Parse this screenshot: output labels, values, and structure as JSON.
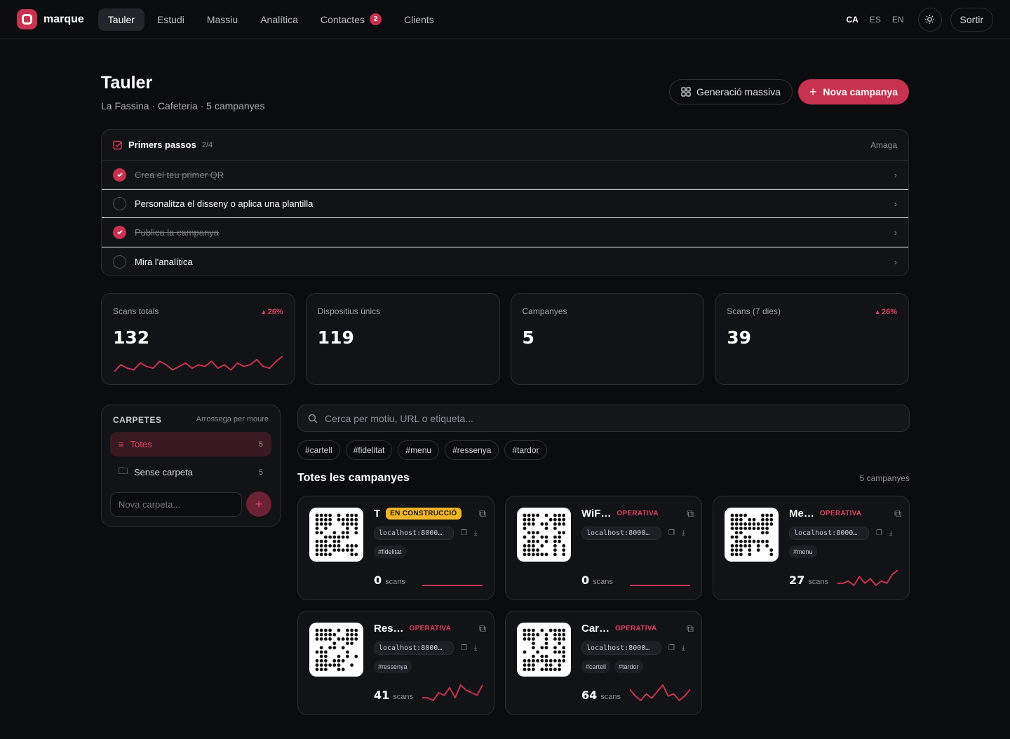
{
  "brand": {
    "name": "marque"
  },
  "nav": [
    {
      "label": "Tauler",
      "active": true
    },
    {
      "label": "Estudi"
    },
    {
      "label": "Massiu"
    },
    {
      "label": "Analítica"
    },
    {
      "label": "Contactes",
      "badge": "2"
    },
    {
      "label": "Clients"
    }
  ],
  "langs": [
    "CA",
    "ES",
    "EN"
  ],
  "signout": "Sortir",
  "page": {
    "title": "Tauler",
    "subtitle": "La Fassina · Cafeteria · 5 campanyes",
    "bulk_button": "Generació massiva",
    "new_button": "Nova campanya"
  },
  "steps": {
    "title": "Primers passos",
    "count": "2/4",
    "hide": "Amaga",
    "items": [
      {
        "label": "Crea el teu primer QR",
        "done": true
      },
      {
        "label": "Personalitza el disseny o aplica una plantilla",
        "done": false
      },
      {
        "label": "Publica la campanya",
        "done": true
      },
      {
        "label": "Mira l'analítica",
        "done": false
      }
    ]
  },
  "stats": [
    {
      "label": "Scans totals",
      "value": "132",
      "delta": "26%",
      "spark": [
        3,
        7,
        5,
        4,
        8,
        6,
        5,
        9,
        7,
        4,
        6,
        8,
        5,
        7,
        6,
        9,
        5,
        7,
        4,
        8,
        6,
        7,
        10,
        6,
        5,
        9,
        12
      ]
    },
    {
      "label": "Dispositius únics",
      "value": "119",
      "delta": ""
    },
    {
      "label": "Campanyes",
      "value": "5",
      "delta": ""
    },
    {
      "label": "Scans (7 dies)",
      "value": "39",
      "delta": "26%"
    }
  ],
  "folders": {
    "title": "CARPETES",
    "hint": "Arrossega per moure",
    "items": [
      {
        "label": "Totes",
        "count": "5",
        "active": true
      },
      {
        "label": "Sense carpeta",
        "count": "5"
      }
    ],
    "new_placeholder": "Nova carpeta..."
  },
  "search": {
    "placeholder": "Cerca per motiu, URL o etiqueta..."
  },
  "tags": [
    "#cartell",
    "#fidelitat",
    "#menu",
    "#ressenya",
    "#tardor"
  ],
  "campaigns": {
    "title": "Totes les campanyes",
    "count": "5 campanyes",
    "items": [
      {
        "name": "T",
        "status": "EN CONSTRUCCIÓ",
        "building": true,
        "url": "localhost:8000…",
        "tags": [
          "#fidelitat"
        ],
        "scans": "0",
        "scans_label": "scans",
        "spark": [
          0,
          0,
          0,
          0,
          0,
          0,
          0,
          0
        ]
      },
      {
        "name": "WiF…",
        "status": "OPERATIVA",
        "url": "localhost:8000…",
        "tags": [],
        "scans": "0",
        "scans_label": "scans",
        "spark": [
          0,
          0,
          0,
          0,
          0,
          0,
          0,
          0
        ]
      },
      {
        "name": "Me…",
        "status": "OPERATIVA",
        "url": "localhost:8000…",
        "tags": [
          "#menu"
        ],
        "scans": "27",
        "scans_label": "scans",
        "spark": [
          2,
          2,
          3,
          1,
          5,
          2,
          4,
          1,
          3,
          2,
          6,
          8
        ]
      },
      {
        "name": "Res…",
        "status": "OPERATIVA",
        "url": "localhost:8000…",
        "tags": [
          "#ressenya"
        ],
        "scans": "41",
        "scans_label": "scans",
        "spark": [
          2,
          2,
          1,
          4,
          3,
          6,
          2,
          7,
          5,
          4,
          3,
          7
        ]
      },
      {
        "name": "Car…",
        "status": "OPERATIVA",
        "url": "localhost:8000…",
        "tags": [
          "#cartell",
          "#tardor"
        ],
        "scans": "64",
        "scans_label": "scans",
        "spark": [
          6,
          3,
          1,
          4,
          2,
          5,
          8,
          3,
          4,
          1,
          3,
          6
        ]
      }
    ]
  },
  "colors": {
    "accent": "#c6324f",
    "accent_text": "#e0405f",
    "bg": "#0b0c0e",
    "card": "#121316",
    "building": "#f0b429"
  }
}
